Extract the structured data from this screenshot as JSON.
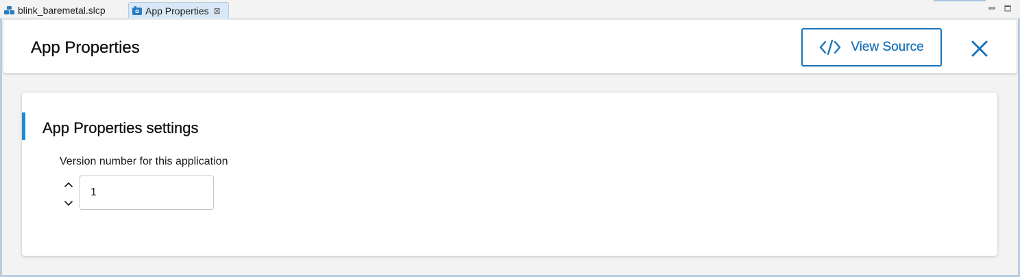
{
  "tabs": [
    {
      "label": "blink_baremetal.slcp",
      "icon": "project-icon",
      "active": false
    },
    {
      "label": "App Properties",
      "icon": "component-icon",
      "active": true,
      "close_glyph": "⊠"
    }
  ],
  "header": {
    "title": "App Properties",
    "view_source_label": "View Source"
  },
  "card": {
    "title": "App Properties settings",
    "field": {
      "label": "Version number for this application",
      "value": "1"
    }
  },
  "colors": {
    "accent": "#1a73b8",
    "card_accent": "#1c8ad8",
    "active_tab": "#d9e8f7"
  }
}
